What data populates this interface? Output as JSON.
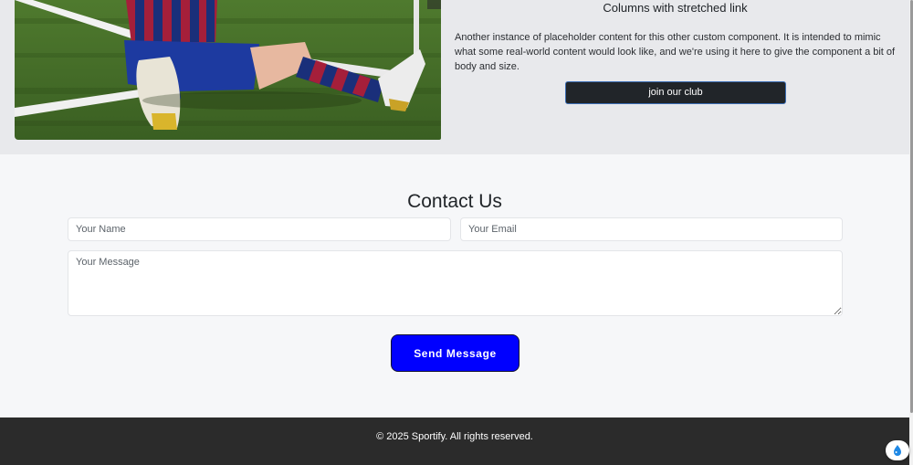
{
  "card": {
    "title": "Columns with stretched link",
    "text": "Another instance of placeholder content for this other custom component. It is intended to mimic what some real-world content would look like, and we're using it here to give the component a bit of body and size.",
    "button_label": "join our club"
  },
  "contact": {
    "title": "Contact Us",
    "name_placeholder": "Your Name",
    "email_placeholder": "Your Email",
    "message_placeholder": "Your Message",
    "send_label": "Send Message"
  },
  "footer": {
    "copyright": "© 2025 Sportify. All rights reserved."
  },
  "colors": {
    "send_button": "#0000ff",
    "club_button": "#212529",
    "footer_bg": "#2b2b2b",
    "card_bg": "#e8e9ec"
  },
  "icons": {
    "floating_widget": "droplet-icon"
  }
}
